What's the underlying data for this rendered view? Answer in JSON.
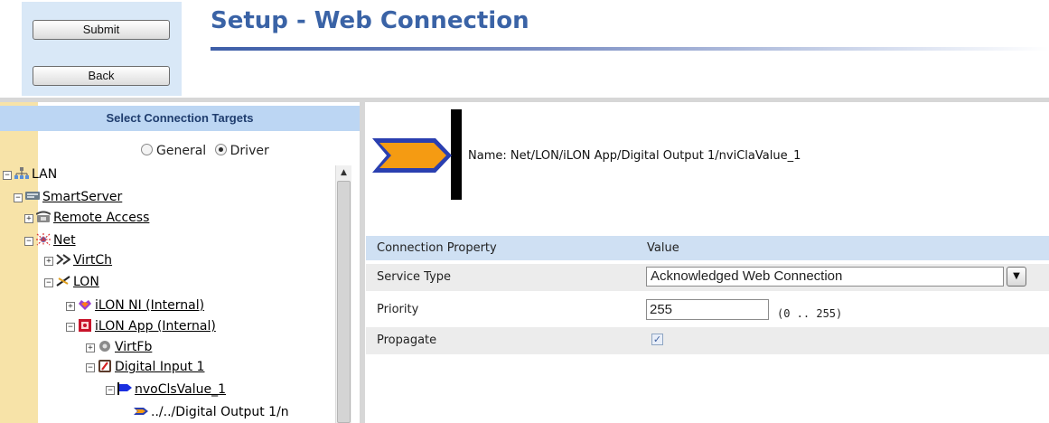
{
  "header": {
    "submit_label": "Submit",
    "back_label": "Back",
    "title": "Setup - Web Connection"
  },
  "left_panel": {
    "title": "Select Connection Targets",
    "radio_general": "General",
    "radio_driver": "Driver",
    "selected_mode": "Driver",
    "tree": [
      {
        "label": "LAN",
        "icon": "network-icon",
        "expanded": true,
        "underline": false
      },
      {
        "label": "SmartServer",
        "icon": "server-icon",
        "expanded": true,
        "underline": true
      },
      {
        "label": "Remote Access",
        "icon": "phone-icon",
        "expanded": false,
        "underline": true
      },
      {
        "label": "Net",
        "icon": "net-icon",
        "expanded": true,
        "underline": true
      },
      {
        "label": "VirtCh",
        "icon": "virtual-channel-icon",
        "expanded": false,
        "underline": true
      },
      {
        "label": "LON",
        "icon": "lon-channel-icon",
        "expanded": true,
        "underline": true
      },
      {
        "label": "iLON NI (Internal)",
        "icon": "network-interface-icon",
        "expanded": false,
        "underline": true
      },
      {
        "label": "iLON App (Internal)",
        "icon": "device-icon",
        "expanded": true,
        "underline": true
      },
      {
        "label": "VirtFb",
        "icon": "gear-icon",
        "expanded": false,
        "underline": true
      },
      {
        "label": "Digital Input 1",
        "icon": "functional-block-icon",
        "expanded": true,
        "underline": true
      },
      {
        "label": "nvoClsValue_1",
        "icon": "output-flag-icon",
        "expanded": true,
        "underline": true
      },
      {
        "label": "../../Digital Output 1/n",
        "icon": "connection-arrow-icon",
        "expanded": null,
        "underline": false
      }
    ]
  },
  "right_panel": {
    "name_text": "Name: Net/LON/iLON App/Digital Output 1/nviClaValue_1",
    "col_property": "Connection Property",
    "col_value": "Value",
    "rows": {
      "service_type_label": "Service Type",
      "service_type_value": "Acknowledged Web Connection",
      "priority_label": "Priority",
      "priority_value": "255",
      "priority_range": "(0 .. 255)",
      "propagate_label": "Propagate",
      "propagate_checked": true
    }
  },
  "colors": {
    "title": "#3a63a6",
    "header_panel": "#d9e8f7",
    "left_strip": "#f7e3a8",
    "grid_header": "#cfe0f3",
    "arrow_fill": "#f59b12",
    "arrow_outline": "#2a3fb0"
  }
}
